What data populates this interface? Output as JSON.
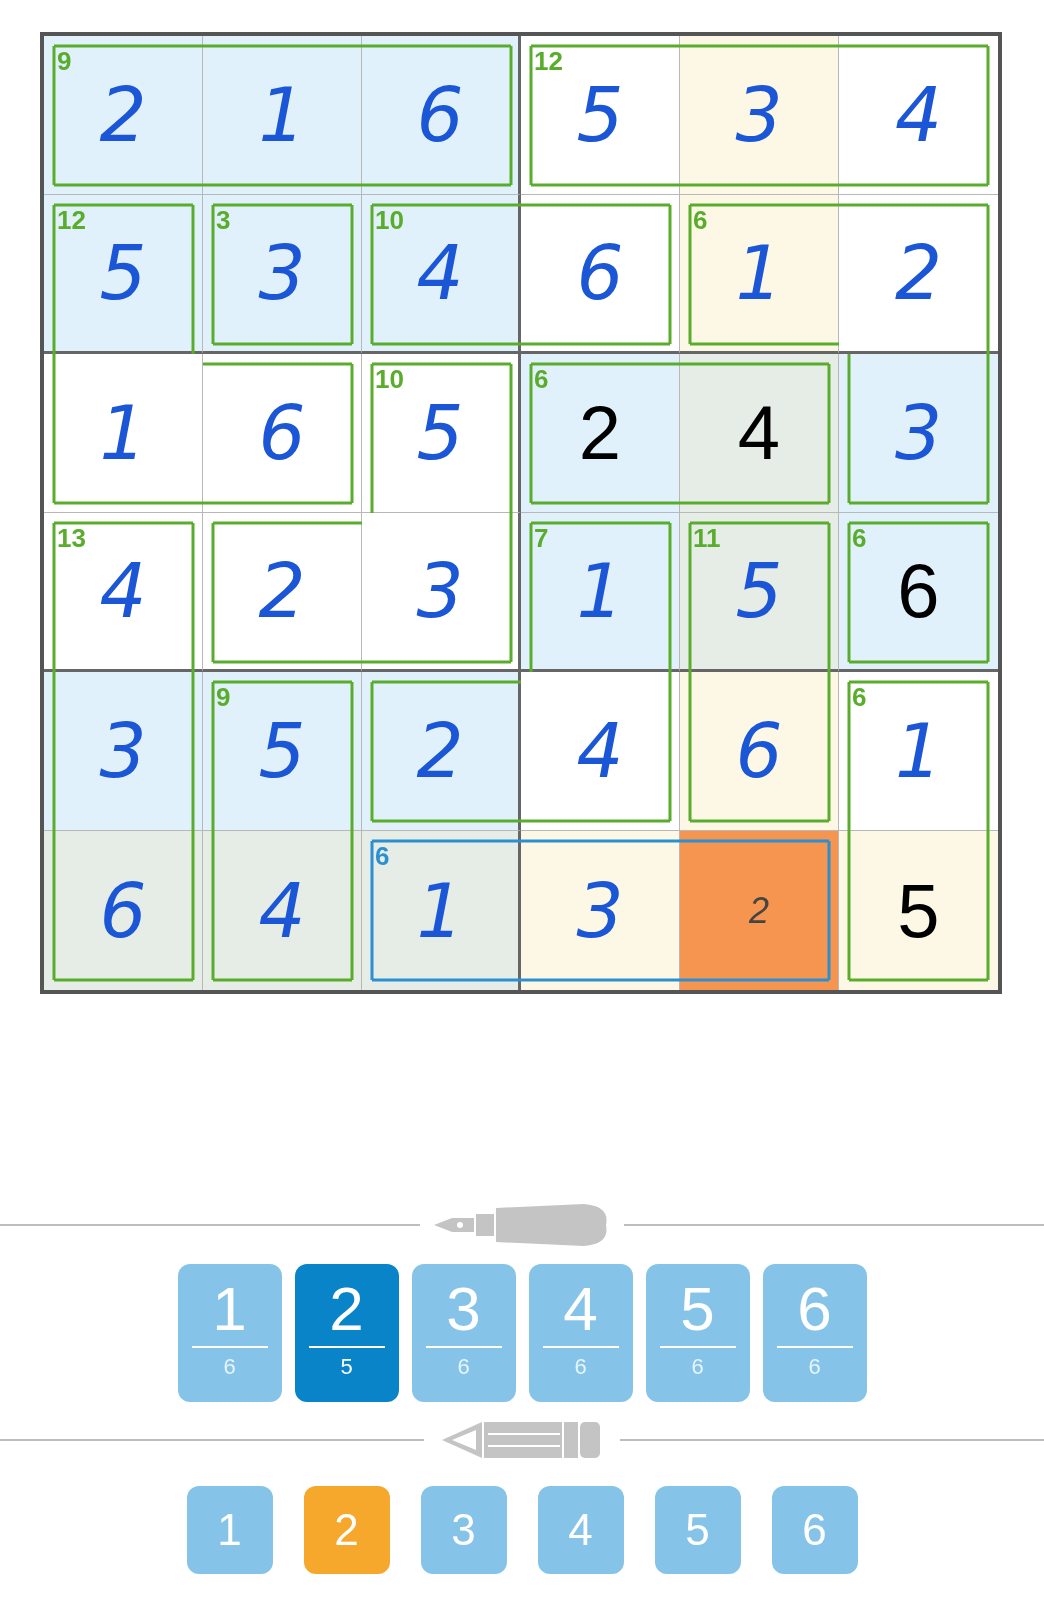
{
  "grid": {
    "rows": [
      [
        {
          "value": "2",
          "kind": "entered",
          "color": "#e1f1fc",
          "walls": {
            "top": true,
            "right": false,
            "bottom": true,
            "left": true
          },
          "cage_label": "9",
          "cage_selected": false
        },
        {
          "value": "1",
          "kind": "entered",
          "color": "#e1f1fc",
          "walls": {
            "top": true,
            "right": false,
            "bottom": true,
            "left": false
          },
          "cage_selected": false
        },
        {
          "value": "6",
          "kind": "entered",
          "color": "#e1f1fc",
          "walls": {
            "top": true,
            "right": true,
            "bottom": true,
            "left": false
          },
          "cage_selected": false
        },
        {
          "value": "5",
          "kind": "entered",
          "color": "#ffffff",
          "walls": {
            "top": true,
            "right": false,
            "bottom": true,
            "left": true
          },
          "cage_label": "12",
          "cage_selected": false
        },
        {
          "value": "3",
          "kind": "entered",
          "color": "#fdf8e6",
          "walls": {
            "top": true,
            "right": false,
            "bottom": true,
            "left": false
          },
          "cage_selected": false
        },
        {
          "value": "4",
          "kind": "entered",
          "color": "#ffffff",
          "walls": {
            "top": true,
            "right": true,
            "bottom": true,
            "left": false
          },
          "cage_selected": false
        }
      ],
      [
        {
          "value": "5",
          "kind": "entered",
          "color": "#e1f1fc",
          "walls": {
            "top": true,
            "right": true,
            "bottom": false,
            "left": true
          },
          "cage_label": "12",
          "cage_selected": false
        },
        {
          "value": "3",
          "kind": "entered",
          "color": "#e1f1fc",
          "walls": {
            "top": true,
            "right": true,
            "bottom": true,
            "left": true
          },
          "cage_label": "3",
          "cage_selected": false
        },
        {
          "value": "4",
          "kind": "entered",
          "color": "#e1f1fc",
          "walls": {
            "top": true,
            "right": false,
            "bottom": true,
            "left": true
          },
          "cage_label": "10",
          "cage_selected": false
        },
        {
          "value": "6",
          "kind": "entered",
          "color": "#ffffff",
          "walls": {
            "top": true,
            "right": true,
            "bottom": true,
            "left": false
          },
          "cage_selected": false
        },
        {
          "value": "1",
          "kind": "entered",
          "color": "#fdf8e6",
          "walls": {
            "top": true,
            "right": false,
            "bottom": true,
            "left": true
          },
          "cage_label": "6",
          "cage_selected": false
        },
        {
          "value": "2",
          "kind": "entered",
          "color": "#ffffff",
          "walls": {
            "top": true,
            "right": true,
            "bottom": false,
            "left": false
          },
          "cage_selected": false
        }
      ],
      [
        {
          "value": "1",
          "kind": "entered",
          "color": "#ffffff",
          "walls": {
            "top": false,
            "right": false,
            "bottom": true,
            "left": true
          },
          "cage_selected": false
        },
        {
          "value": "6",
          "kind": "entered",
          "color": "#ffffff",
          "walls": {
            "top": true,
            "right": true,
            "bottom": true,
            "left": false
          },
          "cage_selected": false
        },
        {
          "value": "5",
          "kind": "entered",
          "color": "#ffffff",
          "walls": {
            "top": true,
            "right": true,
            "bottom": false,
            "left": true
          },
          "cage_label": "10",
          "cage_selected": false
        },
        {
          "value": "2",
          "kind": "given",
          "color": "#e1f1fc",
          "walls": {
            "top": true,
            "right": false,
            "bottom": true,
            "left": true
          },
          "cage_label": "6",
          "cage_selected": false
        },
        {
          "value": "4",
          "kind": "given",
          "color": "#e5ede6",
          "walls": {
            "top": true,
            "right": true,
            "bottom": true,
            "left": false
          },
          "cage_selected": false
        },
        {
          "value": "3",
          "kind": "entered",
          "color": "#e1f1fc",
          "walls": {
            "top": false,
            "right": true,
            "bottom": true,
            "left": true
          },
          "cage_selected": false
        }
      ],
      [
        {
          "value": "4",
          "kind": "entered",
          "color": "#ffffff",
          "walls": {
            "top": true,
            "right": true,
            "bottom": false,
            "left": true
          },
          "cage_label": "13",
          "cage_selected": false
        },
        {
          "value": "2",
          "kind": "entered",
          "color": "#ffffff",
          "walls": {
            "top": true,
            "right": false,
            "bottom": true,
            "left": true
          },
          "cage_selected": false
        },
        {
          "value": "3",
          "kind": "entered",
          "color": "#ffffff",
          "walls": {
            "top": false,
            "right": true,
            "bottom": true,
            "left": false
          },
          "cage_selected": false
        },
        {
          "value": "1",
          "kind": "entered",
          "color": "#e1f1fc",
          "walls": {
            "top": true,
            "right": true,
            "bottom": false,
            "left": true
          },
          "cage_label": "7",
          "cage_selected": false
        },
        {
          "value": "5",
          "kind": "entered",
          "color": "#e5ede6",
          "walls": {
            "top": true,
            "right": true,
            "bottom": false,
            "left": true
          },
          "cage_label": "11",
          "cage_selected": false
        },
        {
          "value": "6",
          "kind": "given",
          "color": "#e1f1fc",
          "walls": {
            "top": true,
            "right": true,
            "bottom": true,
            "left": true
          },
          "cage_label": "6",
          "cage_selected": false
        }
      ],
      [
        {
          "value": "3",
          "kind": "entered",
          "color": "#e1f1fc",
          "walls": {
            "top": false,
            "right": true,
            "bottom": false,
            "left": true
          },
          "cage_selected": false
        },
        {
          "value": "5",
          "kind": "entered",
          "color": "#e1f1fc",
          "walls": {
            "top": true,
            "right": true,
            "bottom": false,
            "left": true
          },
          "cage_label": "9",
          "cage_selected": false
        },
        {
          "value": "2",
          "kind": "entered",
          "color": "#e1f1fc",
          "walls": {
            "top": true,
            "right": false,
            "bottom": true,
            "left": true
          },
          "cage_selected": false
        },
        {
          "value": "4",
          "kind": "entered",
          "color": "#ffffff",
          "walls": {
            "top": false,
            "right": true,
            "bottom": true,
            "left": false
          },
          "cage_selected": false
        },
        {
          "value": "6",
          "kind": "entered",
          "color": "#fdf8e6",
          "walls": {
            "top": false,
            "right": true,
            "bottom": true,
            "left": true
          },
          "cage_selected": false
        },
        {
          "value": "1",
          "kind": "entered",
          "color": "#ffffff",
          "walls": {
            "top": true,
            "right": true,
            "bottom": false,
            "left": true
          },
          "cage_label": "6",
          "cage_selected": false
        }
      ],
      [
        {
          "value": "6",
          "kind": "entered",
          "color": "#e5ede6",
          "walls": {
            "top": false,
            "right": true,
            "bottom": true,
            "left": true
          },
          "cage_selected": false
        },
        {
          "value": "4",
          "kind": "entered",
          "color": "#e5ede6",
          "walls": {
            "top": false,
            "right": true,
            "bottom": true,
            "left": true
          },
          "cage_selected": false
        },
        {
          "value": "1",
          "kind": "entered",
          "color": "#e5ede6",
          "walls": {
            "top": true,
            "right": false,
            "bottom": true,
            "left": true
          },
          "cage_label": "6",
          "cage_selected": true
        },
        {
          "value": "3",
          "kind": "entered",
          "color": "#fdf8e6",
          "walls": {
            "top": true,
            "right": false,
            "bottom": true,
            "left": false
          },
          "cage_selected": true
        },
        {
          "value": "2",
          "kind": "note",
          "color": "#f5954f",
          "walls": {
            "top": true,
            "right": true,
            "bottom": true,
            "left": false
          },
          "cage_selected": true
        },
        {
          "value": "5",
          "kind": "given",
          "color": "#fdf8e6",
          "walls": {
            "top": false,
            "right": true,
            "bottom": true,
            "left": true
          },
          "cage_selected": false
        }
      ]
    ]
  },
  "pen_keys": [
    {
      "digit": "1",
      "count": "6",
      "selected": false
    },
    {
      "digit": "2",
      "count": "5",
      "selected": true
    },
    {
      "digit": "3",
      "count": "6",
      "selected": false
    },
    {
      "digit": "4",
      "count": "6",
      "selected": false
    },
    {
      "digit": "5",
      "count": "6",
      "selected": false
    },
    {
      "digit": "6",
      "count": "6",
      "selected": false
    }
  ],
  "pencil_keys": [
    {
      "digit": "1",
      "selected": false
    },
    {
      "digit": "2",
      "selected": true
    },
    {
      "digit": "3",
      "selected": false
    },
    {
      "digit": "4",
      "selected": false
    },
    {
      "digit": "5",
      "selected": false
    },
    {
      "digit": "6",
      "selected": false
    }
  ]
}
